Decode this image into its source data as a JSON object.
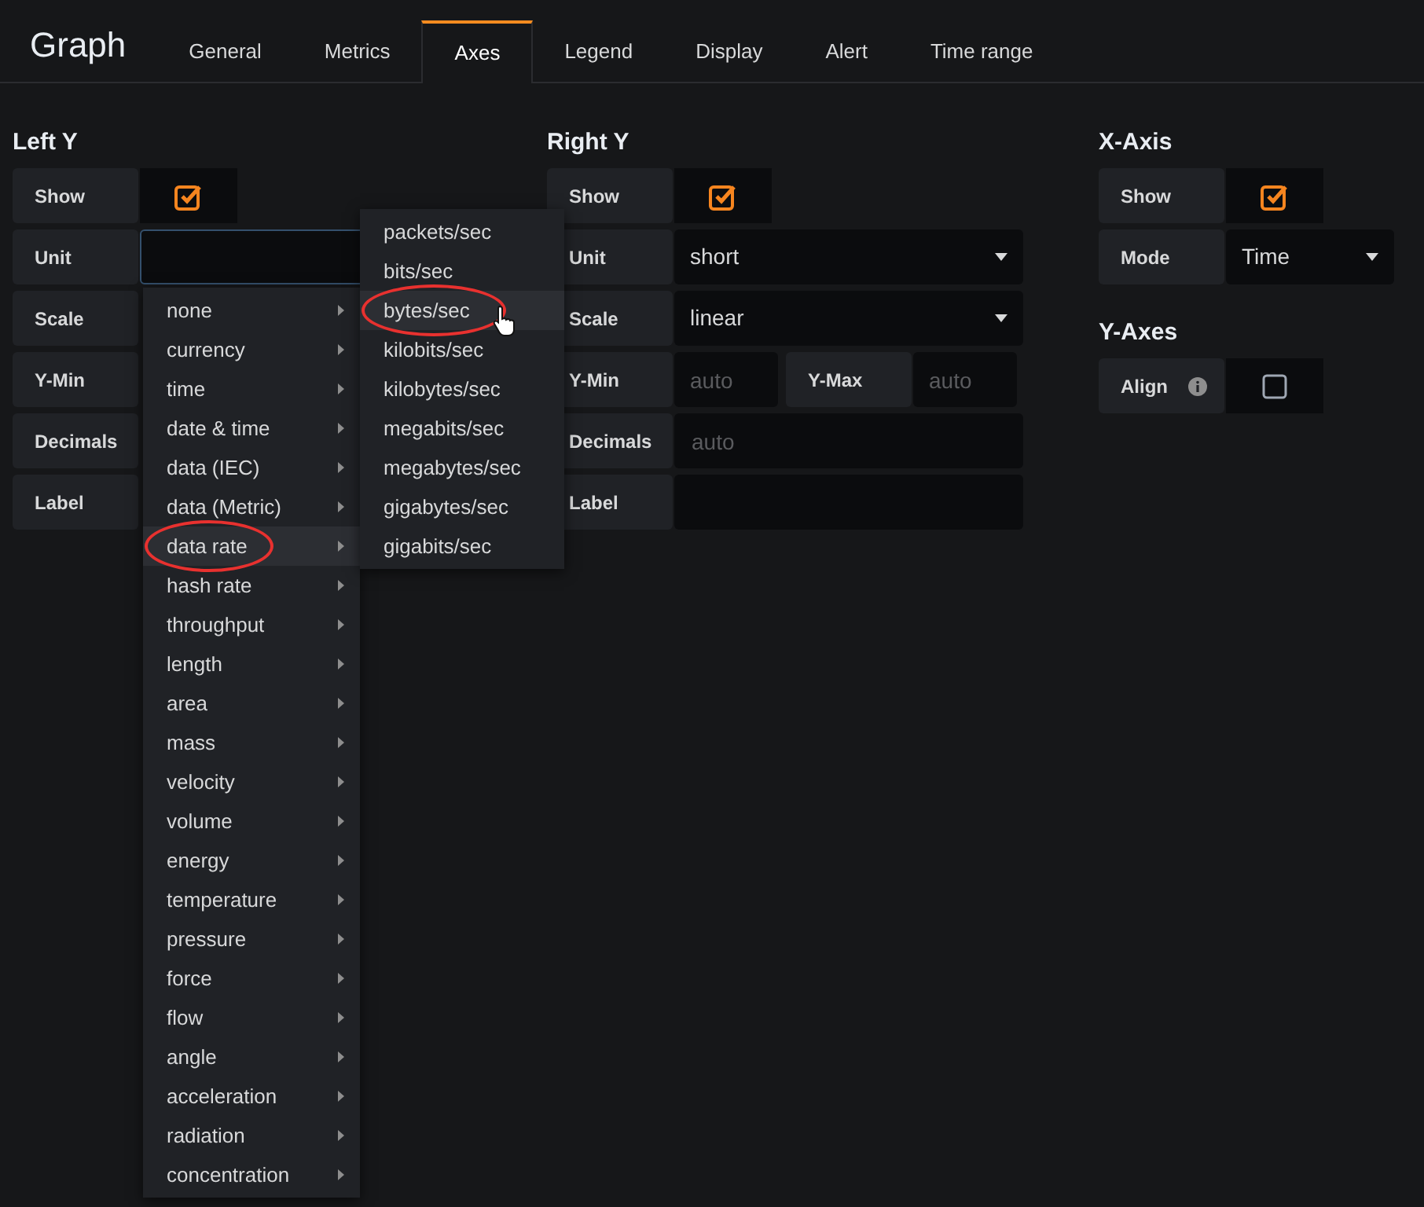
{
  "title": "Graph",
  "tabs": [
    {
      "label": "General",
      "selected": false
    },
    {
      "label": "Metrics",
      "selected": false
    },
    {
      "label": "Axes",
      "selected": true
    },
    {
      "label": "Legend",
      "selected": false
    },
    {
      "label": "Display",
      "selected": false
    },
    {
      "label": "Alert",
      "selected": false
    },
    {
      "label": "Time range",
      "selected": false
    }
  ],
  "columns": [
    {
      "sections": [
        {
          "title": "Left Y",
          "rows": [
            {
              "kind": "checkbox",
              "label": "Show",
              "checked": true
            },
            {
              "kind": "input",
              "label": "Unit",
              "focused": true
            },
            {
              "kind": "label",
              "label": "Scale"
            },
            {
              "kind": "label",
              "label": "Y-Min"
            },
            {
              "kind": "label",
              "label": "Decimals"
            },
            {
              "kind": "label",
              "label": "Label"
            }
          ]
        }
      ]
    },
    {
      "sections": [
        {
          "title": "Right Y",
          "rows": [
            {
              "kind": "checkbox",
              "label": "Show",
              "checked": true
            },
            {
              "kind": "select",
              "label": "Unit",
              "value": "short"
            },
            {
              "kind": "select",
              "label": "Scale",
              "value": "linear"
            },
            {
              "kind": "pair",
              "items": [
                {
                  "label": "Y-Min",
                  "placeholder": "auto"
                },
                {
                  "label": "Y-Max",
                  "placeholder": "auto"
                }
              ]
            },
            {
              "kind": "input",
              "label": "Decimals",
              "placeholder": "auto",
              "focused": false
            },
            {
              "kind": "input",
              "label": "Label",
              "focused": false
            }
          ]
        }
      ]
    },
    {
      "sections": [
        {
          "title": "X-Axis",
          "rows": [
            {
              "kind": "checkbox",
              "label": "Show",
              "checked": true
            },
            {
              "kind": "select",
              "label": "Mode",
              "value": "Time"
            }
          ]
        },
        {
          "title": "Y-Axes",
          "rows": [
            {
              "kind": "checkbox",
              "label": "Align",
              "checked": false,
              "info": true
            }
          ]
        }
      ]
    }
  ],
  "unit_menu": {
    "items": [
      {
        "label": "none",
        "highlighted": false,
        "circled": false
      },
      {
        "label": "currency",
        "highlighted": false,
        "circled": false
      },
      {
        "label": "time",
        "highlighted": false,
        "circled": false
      },
      {
        "label": "date & time",
        "highlighted": false,
        "circled": false
      },
      {
        "label": "data (IEC)",
        "highlighted": false,
        "circled": false
      },
      {
        "label": "data (Metric)",
        "highlighted": false,
        "circled": false
      },
      {
        "label": "data rate",
        "highlighted": true,
        "circled": true
      },
      {
        "label": "hash rate",
        "highlighted": false,
        "circled": false
      },
      {
        "label": "throughput",
        "highlighted": false,
        "circled": false
      },
      {
        "label": "length",
        "highlighted": false,
        "circled": false
      },
      {
        "label": "area",
        "highlighted": false,
        "circled": false
      },
      {
        "label": "mass",
        "highlighted": false,
        "circled": false
      },
      {
        "label": "velocity",
        "highlighted": false,
        "circled": false
      },
      {
        "label": "volume",
        "highlighted": false,
        "circled": false
      },
      {
        "label": "energy",
        "highlighted": false,
        "circled": false
      },
      {
        "label": "temperature",
        "highlighted": false,
        "circled": false
      },
      {
        "label": "pressure",
        "highlighted": false,
        "circled": false
      },
      {
        "label": "force",
        "highlighted": false,
        "circled": false
      },
      {
        "label": "flow",
        "highlighted": false,
        "circled": false
      },
      {
        "label": "angle",
        "highlighted": false,
        "circled": false
      },
      {
        "label": "acceleration",
        "highlighted": false,
        "circled": false
      },
      {
        "label": "radiation",
        "highlighted": false,
        "circled": false
      },
      {
        "label": "concentration",
        "highlighted": false,
        "circled": false
      }
    ]
  },
  "submenu": {
    "items": [
      {
        "label": "packets/sec",
        "highlighted": false,
        "circled": false
      },
      {
        "label": "bits/sec",
        "highlighted": false,
        "circled": false
      },
      {
        "label": "bytes/sec",
        "highlighted": true,
        "circled": true
      },
      {
        "label": "kilobits/sec",
        "highlighted": false,
        "circled": false
      },
      {
        "label": "kilobytes/sec",
        "highlighted": false,
        "circled": false
      },
      {
        "label": "megabits/sec",
        "highlighted": false,
        "circled": false
      },
      {
        "label": "megabytes/sec",
        "highlighted": false,
        "circled": false
      },
      {
        "label": "gigabytes/sec",
        "highlighted": false,
        "circled": false
      },
      {
        "label": "gigabits/sec",
        "highlighted": false,
        "circled": false
      }
    ]
  }
}
